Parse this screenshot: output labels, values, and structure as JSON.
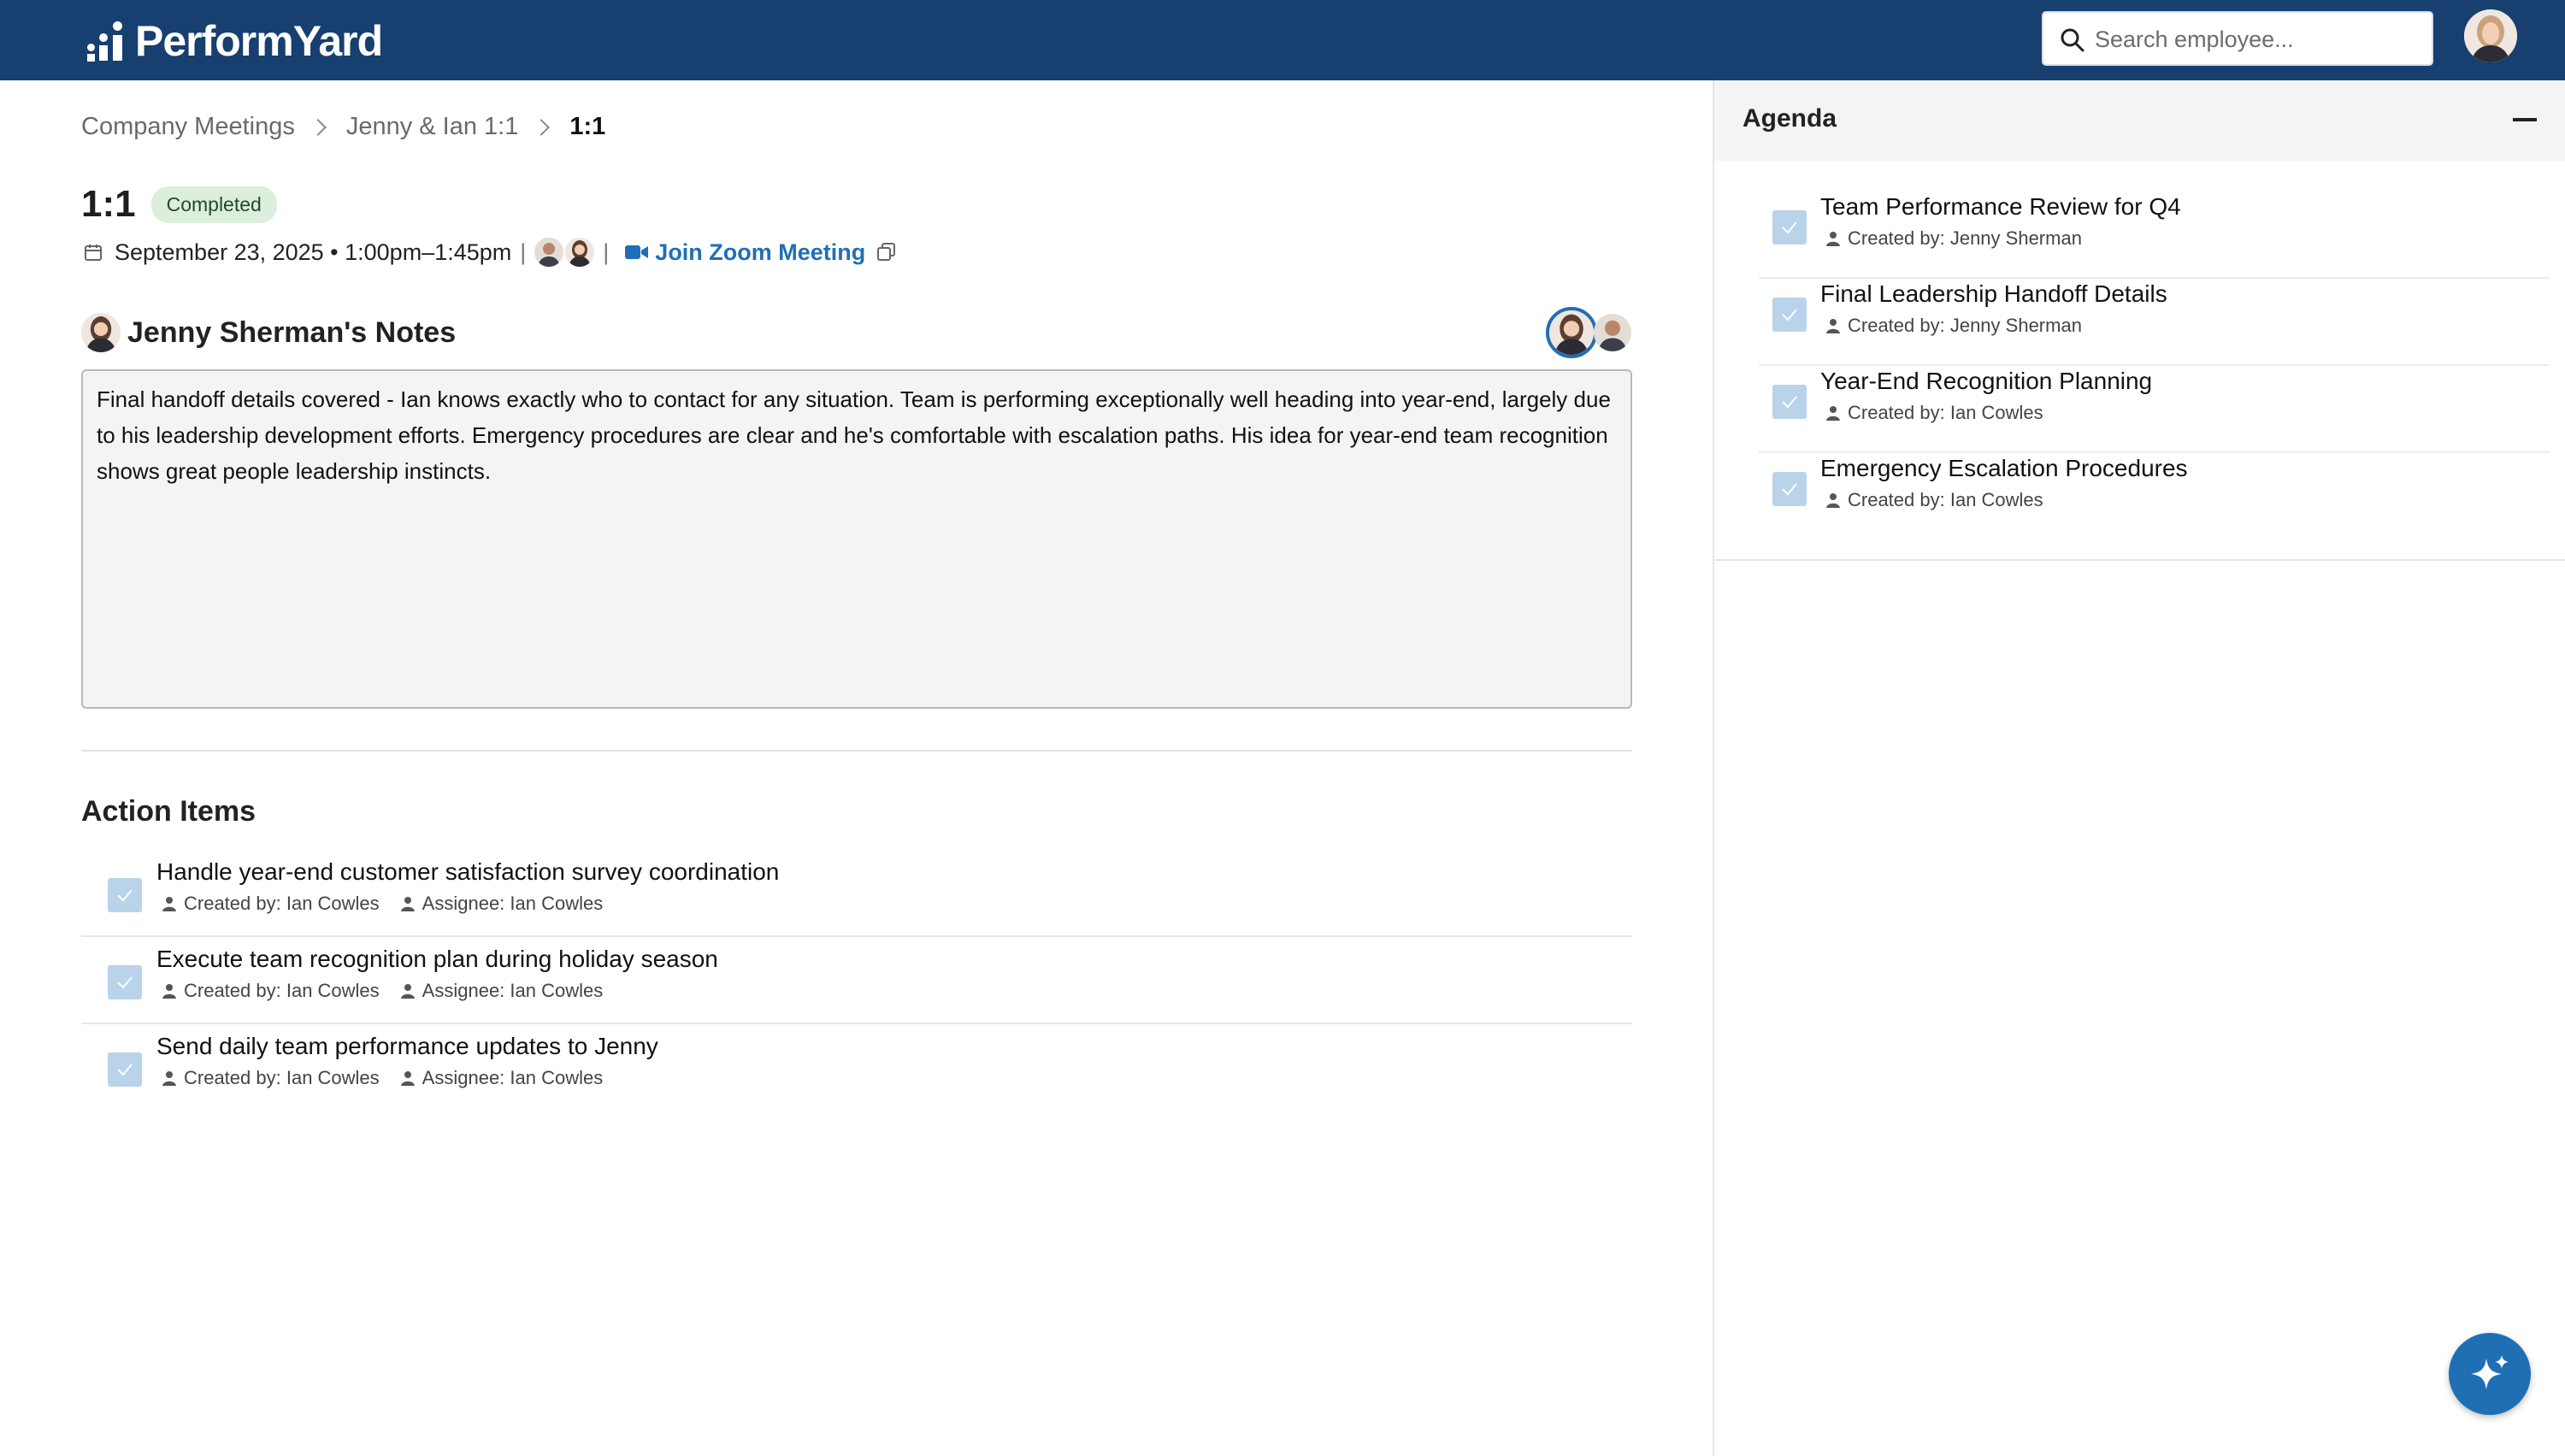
{
  "header": {
    "brand": "PerformYard",
    "search_placeholder": "Search employee...",
    "brand_color": "#173f70"
  },
  "breadcrumb": {
    "items": [
      "Company Meetings",
      "Jenny & Ian 1:1"
    ],
    "current": "1:1"
  },
  "meeting": {
    "title": "1:1",
    "status": "Completed",
    "date_time": "September 23, 2025 • 1:00pm–1:45pm",
    "zoom_label": "Join Zoom Meeting"
  },
  "notes": {
    "title": "Jenny Sherman's Notes",
    "text": "Final handoff details covered - Ian knows exactly who to contact for any situation. Team is performing exceptionally well heading into year-end, largely due to his leadership development efforts. Emergency procedures are clear and he's comfortable with escalation paths. His idea for year-end team recognition shows great people leadership instincts."
  },
  "action_items": {
    "title": "Action Items",
    "items": [
      {
        "title": "Handle year-end customer satisfaction survey coordination",
        "created_by": "Created by: Ian Cowles",
        "assignee": "Assignee: Ian Cowles"
      },
      {
        "title": "Execute team recognition plan during holiday season",
        "created_by": "Created by: Ian Cowles",
        "assignee": "Assignee: Ian Cowles"
      },
      {
        "title": "Send daily team performance updates to Jenny",
        "created_by": "Created by: Ian Cowles",
        "assignee": "Assignee: Ian Cowles"
      }
    ]
  },
  "agenda": {
    "title": "Agenda",
    "items": [
      {
        "title": "Team Performance Review for Q4",
        "created_by": "Created by: Jenny Sherman"
      },
      {
        "title": "Final Leadership Handoff Details",
        "created_by": "Created by: Jenny Sherman"
      },
      {
        "title": "Year-End Recognition Planning",
        "created_by": "Created by: Ian Cowles"
      },
      {
        "title": "Emergency Escalation Procedures",
        "created_by": "Created by: Ian Cowles"
      }
    ]
  }
}
